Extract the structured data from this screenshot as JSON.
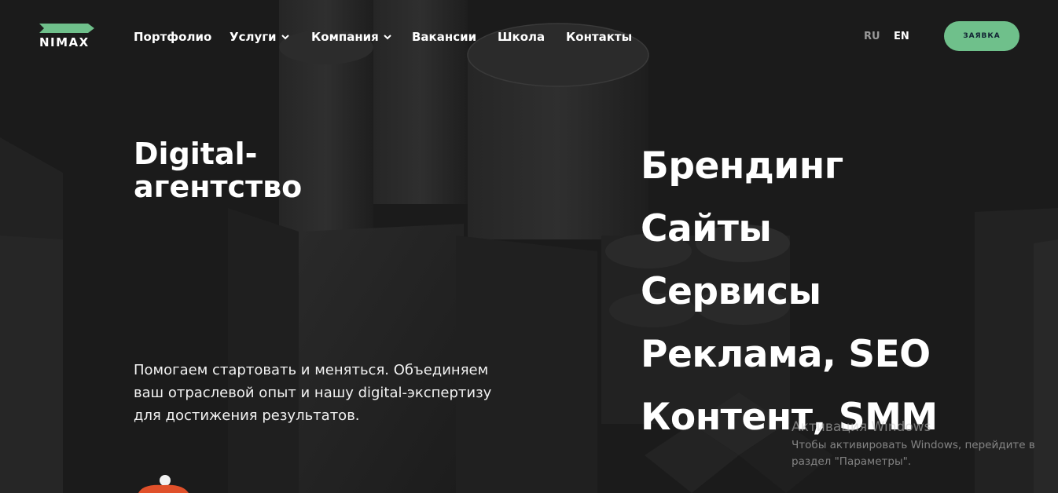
{
  "brand": {
    "logo_text": "NIMAX",
    "accent_color": "#6fc08b"
  },
  "nav": {
    "items": [
      {
        "label": "Портфолио",
        "has_dropdown": false
      },
      {
        "label": "Услуги",
        "has_dropdown": true
      },
      {
        "label": "Компания",
        "has_dropdown": true
      },
      {
        "label": "Вакансии",
        "has_dropdown": false
      },
      {
        "label": "Школа",
        "has_dropdown": false
      },
      {
        "label": "Контакты",
        "has_dropdown": false
      }
    ],
    "languages": [
      {
        "code": "RU",
        "active": false
      },
      {
        "code": "EN",
        "active": true
      }
    ],
    "cta_label": "ЗАЯВКА"
  },
  "hero": {
    "title_line1": "Digital-",
    "title_line2": "агентство",
    "description": "Помогаем стартовать и меняться. Объединяем ваш отраслевой опыт и нашу digital-экспертизу для достижения результатов."
  },
  "services": [
    "Брендинг",
    "Сайты",
    "Сервисы",
    "Реклама, SEO",
    "Контент, SMM"
  ],
  "windows_watermark": {
    "title": "Активация Windows",
    "text": "Чтобы активировать Windows, перейдите в раздел \"Параметры\"."
  }
}
